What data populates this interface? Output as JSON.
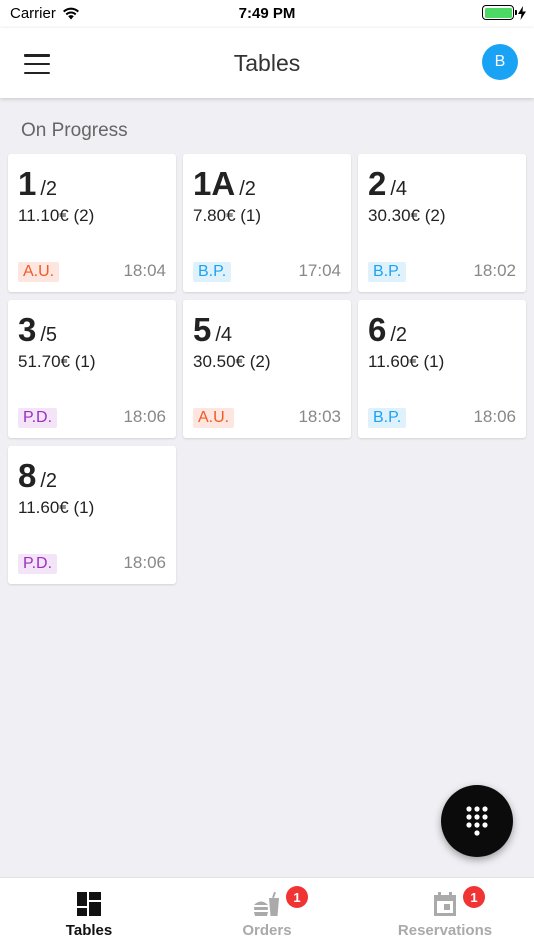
{
  "status_bar": {
    "carrier": "Carrier",
    "time": "7:49 PM"
  },
  "header": {
    "title": "Tables",
    "avatar_initial": "B"
  },
  "section": {
    "title": "On Progress"
  },
  "tables": [
    {
      "number": "1",
      "seats": "/2",
      "amount": "11.10€ (2)",
      "tag": "A.U.",
      "time": "18:04"
    },
    {
      "number": "1A",
      "seats": "/2",
      "amount": "7.80€ (1)",
      "tag": "B.P.",
      "time": "17:04"
    },
    {
      "number": "2",
      "seats": "/4",
      "amount": "30.30€ (2)",
      "tag": "B.P.",
      "time": "18:02"
    },
    {
      "number": "3",
      "seats": "/5",
      "amount": "51.70€ (1)",
      "tag": "P.D.",
      "time": "18:06"
    },
    {
      "number": "5",
      "seats": "/4",
      "amount": "30.50€ (2)",
      "tag": "A.U.",
      "time": "18:03"
    },
    {
      "number": "6",
      "seats": "/2",
      "amount": "11.60€ (1)",
      "tag": "B.P.",
      "time": "18:06"
    },
    {
      "number": "8",
      "seats": "/2",
      "amount": "11.60€ (1)",
      "tag": "P.D.",
      "time": "18:06"
    }
  ],
  "tag_colors": {
    "A.U.": "#f15a24",
    "B.P.": "#1aa3f4",
    "P.D.": "#9c2fc0"
  },
  "fab": {
    "icon": "dialpad-icon"
  },
  "bottom_nav": {
    "items": [
      {
        "label": "Tables",
        "icon": "tables-grid-icon",
        "active": true,
        "badge": ""
      },
      {
        "label": "Orders",
        "icon": "orders-food-icon",
        "active": false,
        "badge": "1"
      },
      {
        "label": "Reservations",
        "icon": "calendar-icon",
        "active": false,
        "badge": "1"
      }
    ]
  }
}
